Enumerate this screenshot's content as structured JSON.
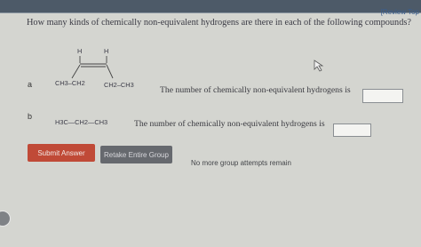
{
  "header": {
    "review_link": "[Review Top"
  },
  "question": "How many kinds of chemically non-equivalent hydrogens are there in each of the following compounds?",
  "parts": [
    {
      "letter": "a",
      "molecule": {
        "h1": "H",
        "h2": "H",
        "left_group": "CH3–CH2",
        "right_group": "CH2–CH3"
      },
      "prompt": "The number of chemically non-equivalent hydrogens is",
      "answer": ""
    },
    {
      "letter": "b",
      "molecule": {
        "formula": "H3C—CH2—CH3"
      },
      "prompt": "The number of chemically non-equivalent hydrogens is",
      "answer": ""
    }
  ],
  "buttons": {
    "submit": "Submit Answer",
    "retake": "Retake Entire Group"
  },
  "status": "No more group attempts remain"
}
